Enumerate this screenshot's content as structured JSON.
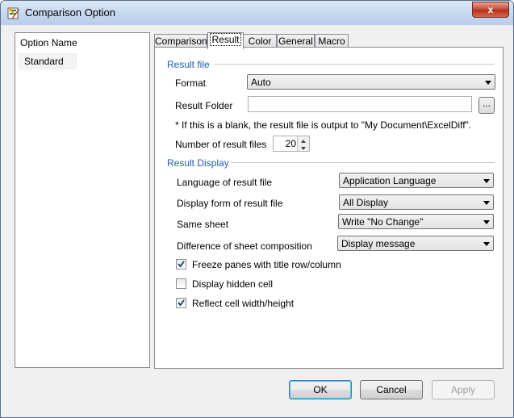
{
  "window": {
    "title": "Comparison Option",
    "close_glyph": "x"
  },
  "left_panel": {
    "header": "Option Name",
    "items": [
      "Standard"
    ]
  },
  "tabs": [
    "Comparison",
    "Result",
    "Color",
    "General",
    "Macro"
  ],
  "active_tab": "Result",
  "result_file": {
    "section_title": "Result file",
    "format_label": "Format",
    "format_value": "Auto",
    "folder_label": "Result Folder",
    "folder_value": "",
    "browse_label": "...",
    "note": "* If this is a blank, the result file is output to \"My Document\\ExcelDiff\".",
    "count_label": "Number of result files",
    "count_value": "20"
  },
  "result_display": {
    "section_title": "Result Display",
    "language_label": "Language of result file",
    "language_value": "Application Language",
    "display_form_label": "Display form of result file",
    "display_form_value": "All Display",
    "same_sheet_label": "Same sheet",
    "same_sheet_value": "Write \"No Change\"",
    "composition_label": "Difference of sheet composition",
    "composition_value": "Display message"
  },
  "checkboxes": [
    {
      "label": "Freeze panes with title row/column",
      "checked": true
    },
    {
      "label": "Display hidden cell",
      "checked": false
    },
    {
      "label": "Reflect cell width/height",
      "checked": true
    }
  ],
  "buttons": {
    "ok": "OK",
    "cancel": "Cancel",
    "apply": "Apply"
  },
  "colors": {
    "section_text": "#1e5fb4",
    "close_button": "#c4452f",
    "titlebar": "#b7cde9"
  },
  "icons": [
    "app-icon",
    "close-icon",
    "chevron-down-icon",
    "spin-up-icon",
    "spin-down-icon",
    "checkmark-icon"
  ]
}
